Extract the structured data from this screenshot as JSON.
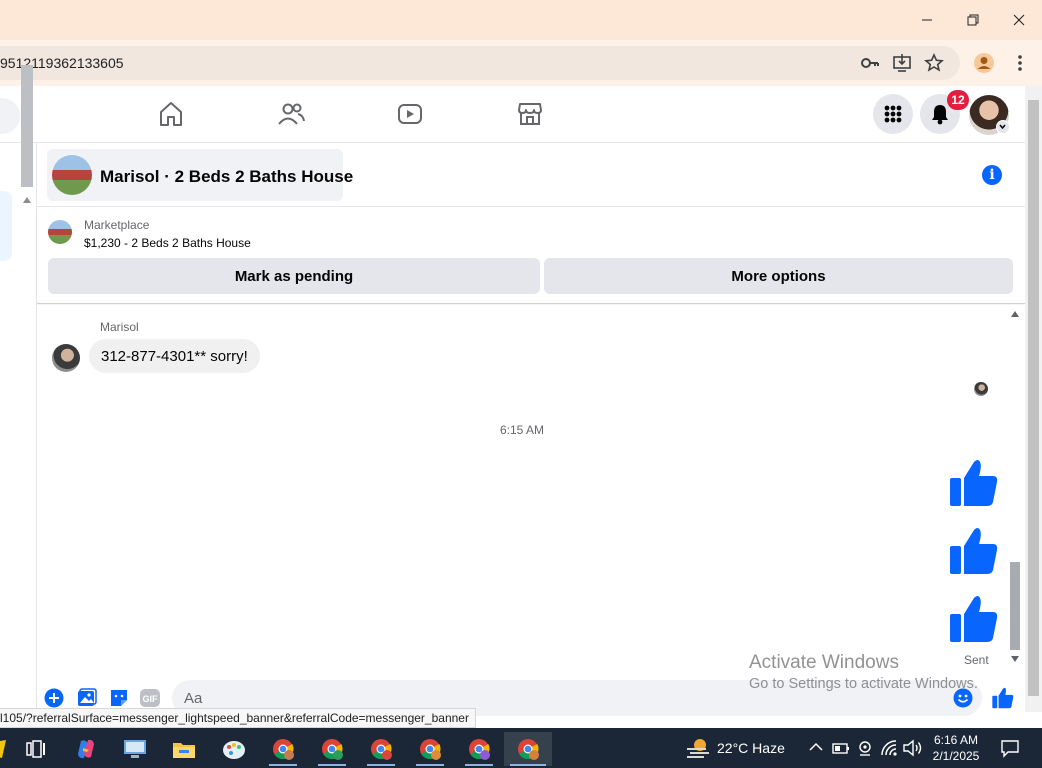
{
  "browser": {
    "url_fragment": "9512119362133605",
    "status_link": "l105/?referralSurface=messenger_lightspeed_banner&referralCode=messenger_banner",
    "icons": [
      "key-icon",
      "install-app-icon",
      "bookmark-star-icon",
      "profile-icon",
      "menu-icon"
    ],
    "window_controls": [
      "minimize-icon",
      "restore-icon",
      "close-icon"
    ]
  },
  "facebook_nav": {
    "tabs": [
      "home-icon",
      "friends-icon",
      "video-icon",
      "marketplace-icon"
    ],
    "notifications_badge": "12"
  },
  "conversation": {
    "title": "Marisol · 2 Beds 2 Baths House",
    "listing": {
      "label": "Marketplace",
      "title": "$1,230 - 2 Beds 2 Baths House"
    },
    "actions": {
      "mark_pending": "Mark as pending",
      "more_options": "More options"
    },
    "messages": {
      "sender": "Marisol",
      "text": "312-877-4301** sorry!",
      "timestamp": "6:15 AM",
      "likes_count": 3,
      "sent_label": "Sent"
    },
    "composer": {
      "placeholder": "Aa"
    }
  },
  "watermark": {
    "line1": "Activate Windows",
    "line2": "Go to Settings to activate Windows."
  },
  "taskbar": {
    "weather": "22°C  Haze",
    "time": "6:16 AM",
    "date": "2/1/2025"
  },
  "colors": {
    "fb_blue": "#0866ff",
    "badge_red": "#e41e3f",
    "titlebar": "#fde7d6",
    "taskbar": "#1b2736"
  }
}
